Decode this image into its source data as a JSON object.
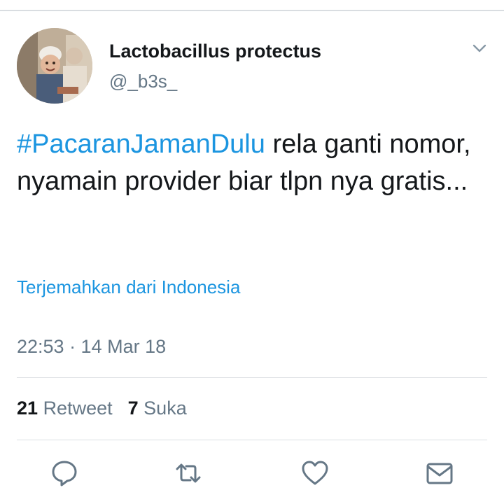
{
  "tweet": {
    "author": {
      "display_name": "Lactobacillus protectus",
      "handle": "@_b3s_"
    },
    "text": {
      "hashtag": "#PacaranJamanDulu",
      "body": " rela ganti nomor,  nyamain provider biar tlpn nya gratis..."
    },
    "translate_link": "Terjemahkan dari Indonesia",
    "timestamp": "22:53 · 14 Mar 18",
    "stats": {
      "retweet_count": "21",
      "retweet_label": "Retweet",
      "like_count": "7",
      "like_label": "Suka"
    },
    "actions": {
      "reply_icon": "reply-icon",
      "retweet_icon": "retweet-icon",
      "like_icon": "heart-icon",
      "message_icon": "envelope-icon"
    }
  },
  "colors": {
    "link": "#1b95e0",
    "secondary_text": "#657786",
    "primary_text": "#14171a",
    "icon": "#657786",
    "divider": "#dcdfe3"
  }
}
